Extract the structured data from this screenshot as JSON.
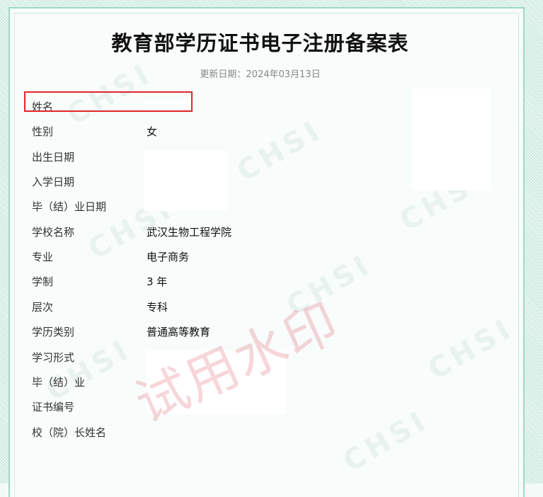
{
  "document": {
    "title": "教育部学历证书电子注册备案表",
    "update_date": "更新日期：2024年03月13日",
    "watermark": "试用水印",
    "bg_pattern_text": "CHSI"
  },
  "fields": [
    {
      "label": "姓名",
      "value": ""
    },
    {
      "label": "性别",
      "value": "女"
    },
    {
      "label": "出生日期",
      "value": ""
    },
    {
      "label": "入学日期",
      "value": ""
    },
    {
      "label": "毕（结）业日期",
      "value": ""
    },
    {
      "label": "学校名称",
      "value": "武汉生物工程学院"
    },
    {
      "label": "专业",
      "value": "电子商务"
    },
    {
      "label": "学制",
      "value": "3 年"
    },
    {
      "label": "层次",
      "value": "专科"
    },
    {
      "label": "学历类别",
      "value": "普通高等教育"
    },
    {
      "label": "学习形式",
      "value": ""
    },
    {
      "label": "毕（结）业",
      "value": ""
    },
    {
      "label": "证书编号",
      "value": ""
    },
    {
      "label": "校（院）长姓名",
      "value": ""
    }
  ],
  "colors": {
    "border_accent": "#9fd8c6",
    "highlight_box": "#e2262b",
    "watermark": "#e67882"
  }
}
